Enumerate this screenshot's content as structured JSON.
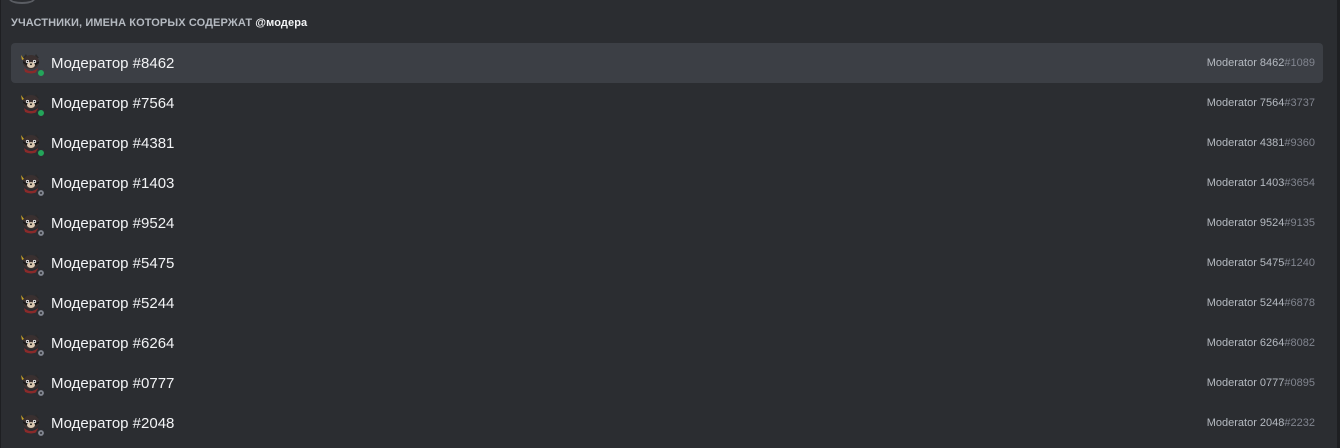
{
  "header": {
    "prefix": "УЧАСТНИКИ, ИМЕНА КОТОРЫХ СОДЕРЖАТ",
    "query": "@модера"
  },
  "colors": {
    "background": "#2b2d31",
    "selected_row": "#3c3f45",
    "online": "#23a55a",
    "offline": "#80848e"
  },
  "members": [
    {
      "name": "Модератор #8462",
      "username": "Moderator 8462",
      "discriminator": "#1089",
      "status": "online",
      "selected": true,
      "avatar_icon": "raccoon-avatar-icon"
    },
    {
      "name": "Модератор #7564",
      "username": "Moderator 7564",
      "discriminator": "#3737",
      "status": "online",
      "selected": false,
      "avatar_icon": "raccoon-avatar-icon"
    },
    {
      "name": "Модератор #4381",
      "username": "Moderator 4381",
      "discriminator": "#9360",
      "status": "online",
      "selected": false,
      "avatar_icon": "raccoon-avatar-icon"
    },
    {
      "name": "Модератор #1403",
      "username": "Moderator 1403",
      "discriminator": "#3654",
      "status": "offline",
      "selected": false,
      "avatar_icon": "raccoon-avatar-icon"
    },
    {
      "name": "Модератор #9524",
      "username": "Moderator 9524",
      "discriminator": "#9135",
      "status": "offline",
      "selected": false,
      "avatar_icon": "raccoon-avatar-icon"
    },
    {
      "name": "Модератор #5475",
      "username": "Moderator 5475",
      "discriminator": "#1240",
      "status": "offline",
      "selected": false,
      "avatar_icon": "raccoon-avatar-icon"
    },
    {
      "name": "Модератор #5244",
      "username": "Moderator 5244",
      "discriminator": "#6878",
      "status": "offline",
      "selected": false,
      "avatar_icon": "raccoon-avatar-icon"
    },
    {
      "name": "Модератор #6264",
      "username": "Moderator 6264",
      "discriminator": "#8082",
      "status": "offline",
      "selected": false,
      "avatar_icon": "raccoon-avatar-icon"
    },
    {
      "name": "Модератор #0777",
      "username": "Moderator 0777",
      "discriminator": "#0895",
      "status": "offline",
      "selected": false,
      "avatar_icon": "raccoon-avatar-icon"
    },
    {
      "name": "Модератор #2048",
      "username": "Moderator 2048",
      "discriminator": "#2232",
      "status": "offline",
      "selected": false,
      "avatar_icon": "raccoon-avatar-icon"
    }
  ]
}
